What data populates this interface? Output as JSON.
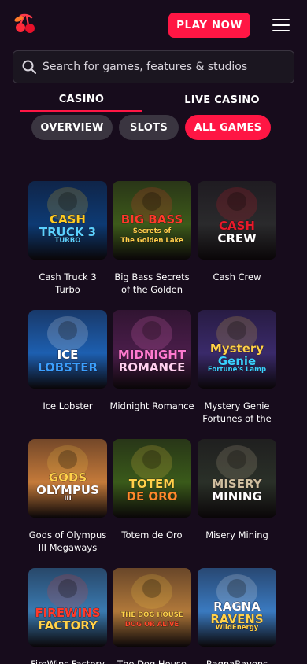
{
  "header": {
    "play_label": "PLAY NOW",
    "logo_icon": "cherry-icon",
    "menu_icon": "hamburger-menu-icon",
    "accent": "#ff1644"
  },
  "search": {
    "placeholder": "Search for games, features & studios",
    "value": ""
  },
  "tabs": [
    {
      "label": "CASINO",
      "active": true
    },
    {
      "label": "LIVE CASINO",
      "active": false
    }
  ],
  "filters": [
    {
      "label": "OVERVIEW",
      "active": false
    },
    {
      "label": "SLOTS",
      "active": false
    },
    {
      "label": "ALL GAMES",
      "active": true
    }
  ],
  "games": [
    {
      "title": "Cash Truck 3 Turbo",
      "logo_lines": [
        "CASH",
        "TRUCK 3",
        "TURBO"
      ],
      "bg": "#0d3a73"
    },
    {
      "title": "Big Bass Secrets of the Golden",
      "logo_lines": [
        "BIG BASS",
        "Secrets of",
        "The Golden Lake"
      ],
      "bg": "#3d5a1a"
    },
    {
      "title": "Cash Crew",
      "logo_lines": [
        "CASH",
        "CREW"
      ],
      "bg": "#2a2a2c"
    },
    {
      "title": "Ice Lobster",
      "logo_lines": [
        "ICE",
        "LOBSTER"
      ],
      "bg": "#1d5fb0"
    },
    {
      "title": "Midnight Romance",
      "logo_lines": [
        "MIDNIGHT",
        "ROMANCE"
      ],
      "bg": "#4a1d4a"
    },
    {
      "title": "Mystery Genie Fortunes of the",
      "logo_lines": [
        "Mystery",
        "Genie",
        "Fortune's Lamp"
      ],
      "bg": "#3a2a6a"
    },
    {
      "title": "Gods of Olympus III Megaways",
      "logo_lines": [
        "GODS",
        "OLYMPUS",
        "III"
      ],
      "bg": "#c47a3a"
    },
    {
      "title": "Totem de Oro",
      "logo_lines": [
        "TOTEM",
        "DE ORO"
      ],
      "bg": "#3a5a1a"
    },
    {
      "title": "Misery Mining",
      "logo_lines": [
        "MISERY",
        "MINING"
      ],
      "bg": "#2a3028"
    },
    {
      "title": "FireWins Factory",
      "logo_lines": [
        "FIREWINS",
        "FACTORY"
      ],
      "bg": "#3a7ab0"
    },
    {
      "title": "The Dog House Dog or Alive",
      "logo_lines": [
        "THE DOG HOUSE",
        "DOG OR ALIVE"
      ],
      "bg": "#b0783a"
    },
    {
      "title": "RagnaRavens",
      "logo_lines": [
        "RAGNA",
        "RAVENS",
        "WildEnergy"
      ],
      "bg": "#3a7ac0"
    }
  ]
}
